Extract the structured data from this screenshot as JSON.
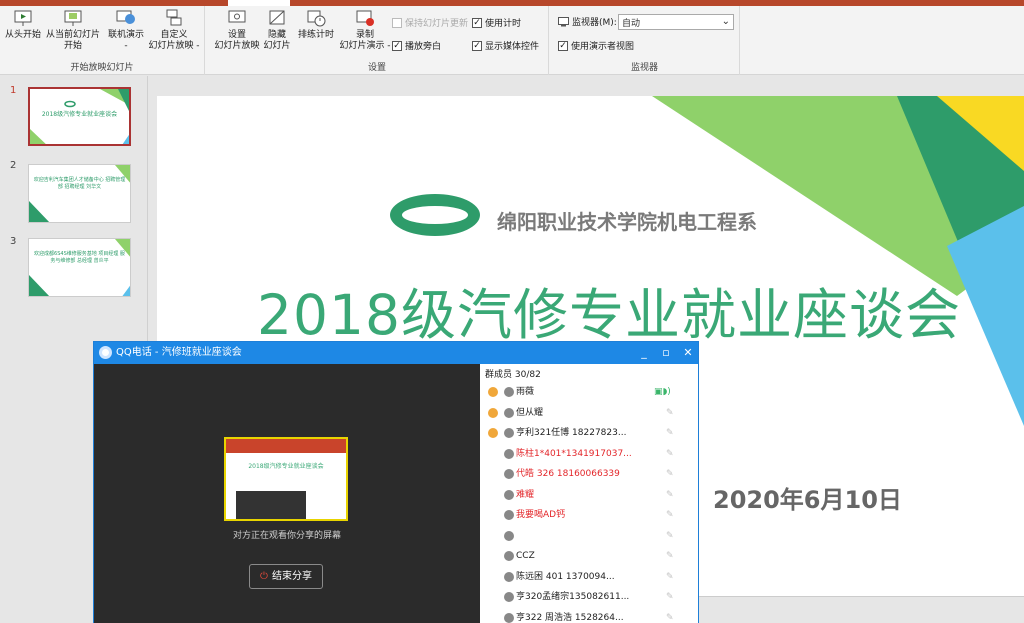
{
  "ribbon": {
    "groups": {
      "start": {
        "label": "开始放映幻灯片",
        "from_start": "从头开始",
        "from_current_1": "从当前幻灯片",
        "from_current_2": "开始",
        "online_1": "联机演示",
        "online_2": "-",
        "custom_1": "自定义",
        "custom_2": "幻灯片放映 -"
      },
      "setup": {
        "label": "设置",
        "setup_show_1": "设置",
        "setup_show_2": "幻灯片放映",
        "hide_1": "隐藏",
        "hide_2": "幻灯片",
        "rehearse": "排练计时",
        "record_1": "录制",
        "record_2": "幻灯片演示 -",
        "keep_updated": "保持幻灯片更新",
        "play_narration": "播放旁白",
        "use_timings": "使用计时",
        "show_media": "显示媒体控件"
      },
      "monitors": {
        "label": "监视器",
        "monitor_label": "监视器(M):",
        "monitor_value": "自动",
        "presenter_view": "使用演示者视图"
      }
    }
  },
  "thumbnails": [
    {
      "num": "1",
      "text": "2018级汽修专业就业座谈会",
      "active": true
    },
    {
      "num": "2",
      "text": "欢迎吉利汽车集团人才储备中心 招聘管理部 招聘经理 刘华文",
      "active": false
    },
    {
      "num": "3",
      "text": "欢迎成都6S4S维修服务基地 项目经理 服务与维修部 总经理 曾炎平",
      "active": false
    }
  ],
  "slide": {
    "org": "绵阳职业技术学院机电工程系",
    "title": "2018级汽修专业就业座谈会",
    "date": "2020年6月10日",
    "colors": {
      "green": "#3aa876",
      "dark_green": "#2e9c6a",
      "yellow": "#f9d923",
      "light_green": "#8fd16a",
      "blue": "#5bc0eb"
    }
  },
  "qq": {
    "title": "QQ电话 - 汽修班就业座谈会",
    "preview_title": "2018级汽修专业就业座谈会",
    "watching": "对方正在观看你分享的屏幕",
    "end_share": "结束分享",
    "members_count": "群成员 30/82",
    "members": [
      {
        "name": "雨薇",
        "host": true,
        "red": false,
        "mic": "on"
      },
      {
        "name": "但从耀",
        "host": true,
        "red": false,
        "mic": "off"
      },
      {
        "name": "亨利321任博 18227823...",
        "host": true,
        "red": false,
        "mic": "off"
      },
      {
        "name": "陈柱1*401*1341917037...",
        "host": false,
        "red": true,
        "mic": "off"
      },
      {
        "name": "代皓 326 18160066339",
        "host": false,
        "red": true,
        "mic": "off"
      },
      {
        "name": "难耀",
        "host": false,
        "red": true,
        "mic": "off"
      },
      {
        "name": "我要喝AD钙",
        "host": false,
        "red": true,
        "mic": "off"
      },
      {
        "name": "",
        "host": false,
        "red": false,
        "mic": "off"
      },
      {
        "name": "CCZ",
        "host": false,
        "red": false,
        "mic": "off"
      },
      {
        "name": "陈远困  401   1370094...",
        "host": false,
        "red": false,
        "mic": "off"
      },
      {
        "name": "亨320孟绪宗135082611...",
        "host": false,
        "red": false,
        "mic": "off"
      },
      {
        "name": "亨322  周浩浩 1528264...",
        "host": false,
        "red": false,
        "mic": "off"
      }
    ]
  }
}
